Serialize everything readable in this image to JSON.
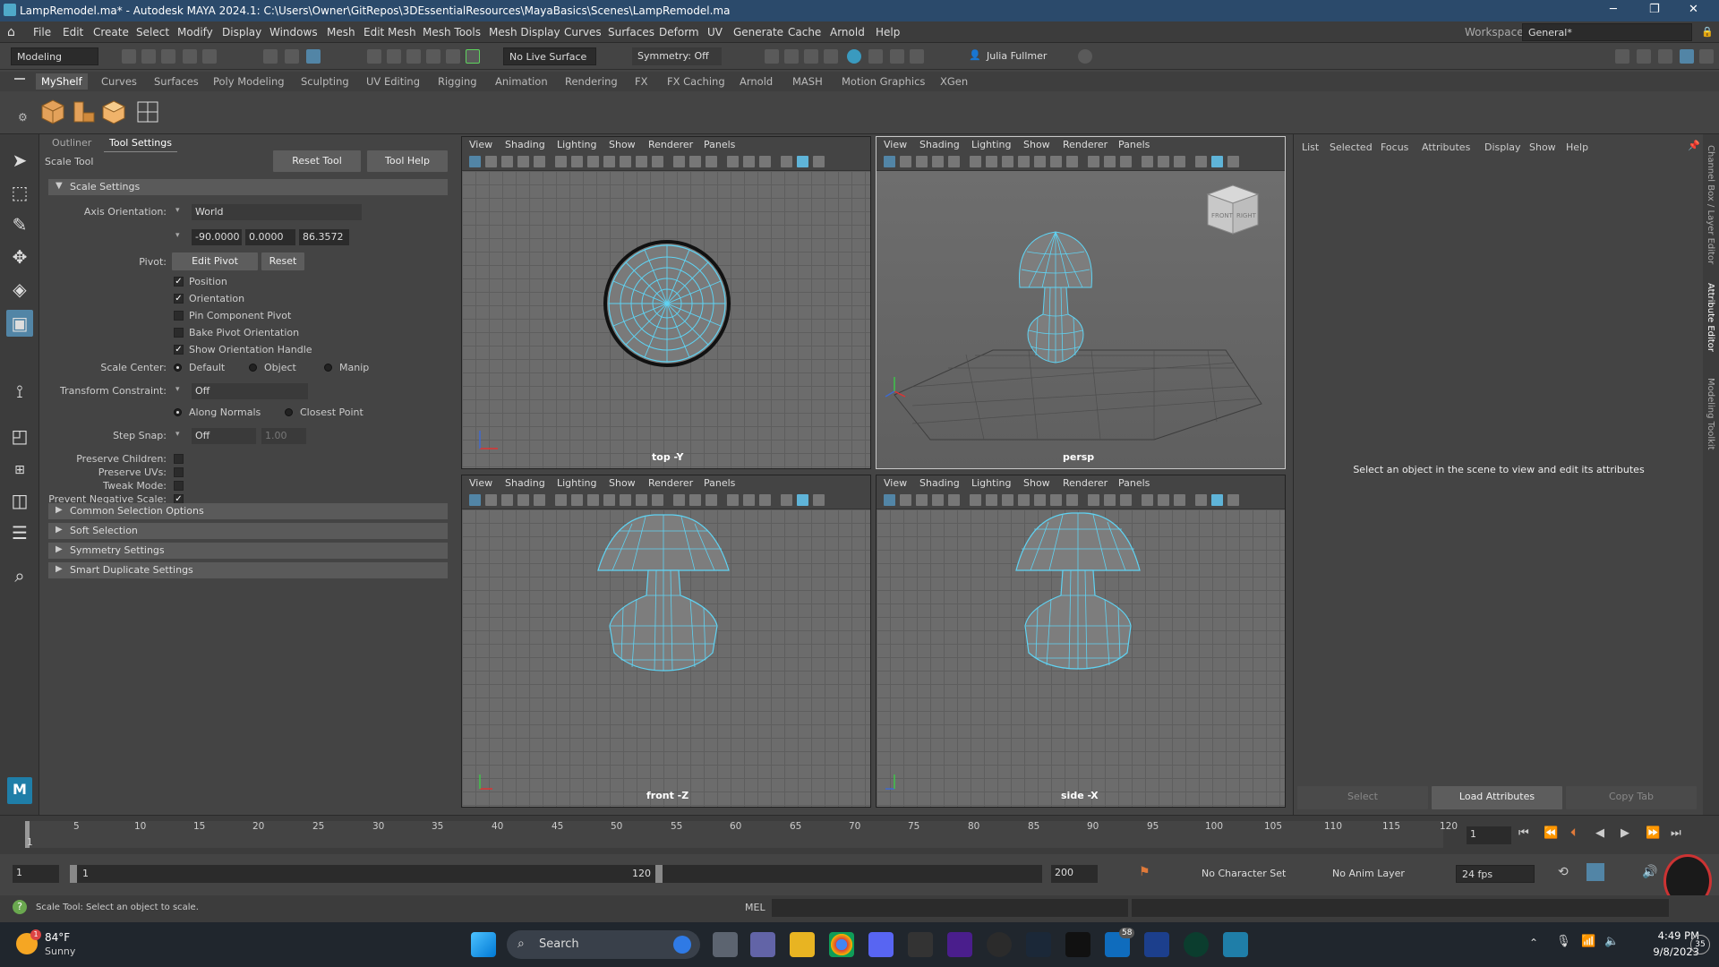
{
  "window": {
    "title": "LampRemodel.ma* - Autodesk MAYA 2024.1: C:\\Users\\Owner\\GitRepos\\3DEssentialResources\\MayaBasics\\Scenes\\LampRemodel.ma"
  },
  "menubar": {
    "items": [
      "File",
      "Edit",
      "Create",
      "Select",
      "Modify",
      "Display",
      "Windows",
      "Mesh",
      "Edit Mesh",
      "Mesh Tools",
      "Mesh Display",
      "Curves",
      "Surfaces",
      "Deform",
      "UV",
      "Generate",
      "Cache",
      "Arnold",
      "Help"
    ],
    "workspace_label": "Workspace:",
    "workspace_value": "General*"
  },
  "statusline": {
    "menuset": "Modeling",
    "live_surface": "No Live Surface",
    "symmetry": "Symmetry: Off",
    "user": "Julia Fullmer"
  },
  "shelf": {
    "tabs": [
      "MyShelf",
      "Curves",
      "Surfaces",
      "Poly Modeling",
      "Sculpting",
      "UV Editing",
      "Rigging",
      "Animation",
      "Rendering",
      "FX",
      "FX Caching",
      "Arnold",
      "MASH",
      "Motion Graphics",
      "XGen"
    ],
    "active_tab": "MyShelf"
  },
  "toolsettings": {
    "tabs": [
      "Outliner",
      "Tool Settings"
    ],
    "tool_name": "Scale Tool",
    "reset_tool": "Reset Tool",
    "tool_help": "Tool Help",
    "scale_settings": "Scale Settings",
    "axis_orientation_label": "Axis Orientation:",
    "axis_orientation_value": "World",
    "axis_x": "-90.0000",
    "axis_y": "0.0000",
    "axis_z": "86.3572",
    "pivot_label": "Pivot:",
    "edit_pivot": "Edit Pivot",
    "reset": "Reset",
    "position": "Position",
    "orientation": "Orientation",
    "pin_component_pivot": "Pin Component Pivot",
    "bake_pivot_orientation": "Bake Pivot Orientation",
    "show_orientation_handle": "Show Orientation Handle",
    "scale_center_label": "Scale Center:",
    "sc_default": "Default",
    "sc_object": "Object",
    "sc_manip": "Manip",
    "transform_constraint_label": "Transform Constraint:",
    "transform_constraint_value": "Off",
    "along_normals": "Along Normals",
    "closest_point": "Closest Point",
    "step_snap_label": "Step Snap:",
    "step_snap_value": "Off",
    "step_snap_amount": "1.00",
    "preserve_children": "Preserve Children:",
    "preserve_uvs": "Preserve UVs:",
    "tweak_mode": "Tweak Mode:",
    "prevent_negative_scale": "Prevent Negative Scale:",
    "sections": [
      "Common Selection Options",
      "Soft Selection",
      "Symmetry Settings",
      "Smart Duplicate Settings"
    ]
  },
  "viewports": {
    "menu": [
      "View",
      "Shading",
      "Lighting",
      "Show",
      "Renderer",
      "Panels"
    ],
    "top_label": "top -Y",
    "persp_label": "persp",
    "front_label": "front -Z",
    "side_label": "side -X",
    "viewcube_front": "FRONT",
    "viewcube_right": "RIGHT"
  },
  "attribute_editor": {
    "menu": [
      "List",
      "Selected",
      "Focus",
      "Attributes",
      "Display",
      "Show",
      "Help"
    ],
    "message": "Select an object in the scene to view and edit its attributes",
    "buttons": [
      "Select",
      "Load Attributes",
      "Copy Tab"
    ],
    "side_tabs": [
      "Channel Box / Layer Editor",
      "Attribute Editor",
      "Modeling Toolkit"
    ]
  },
  "timeline": {
    "ticks": [
      "1",
      "5",
      "10",
      "15",
      "20",
      "25",
      "30",
      "35",
      "40",
      "45",
      "50",
      "55",
      "60",
      "65",
      "70",
      "75",
      "80",
      "85",
      "90",
      "95",
      "100",
      "105",
      "110",
      "115",
      "120"
    ],
    "current_frame": "1",
    "range_start": "1",
    "range_inner_start": "1",
    "range_inner_end": "120",
    "range_end": "200",
    "character_set": "No Character Set",
    "anim_layer": "No Anim Layer",
    "fps": "24 fps"
  },
  "commandline": {
    "help_text": "Scale Tool: Select an object to scale.",
    "mel_label": "MEL"
  },
  "taskbar": {
    "weather_temp": "84°F",
    "weather_desc": "Sunny",
    "weather_badge": "1",
    "search_placeholder": "Search",
    "teams_badge": "58",
    "time": "4:49 PM",
    "date": "9/8/2023",
    "notif_count": "35"
  },
  "colors": {
    "accent": "#5285a6",
    "wireframe": "#5fd3f3",
    "titlebar": "#2b4a6b"
  }
}
